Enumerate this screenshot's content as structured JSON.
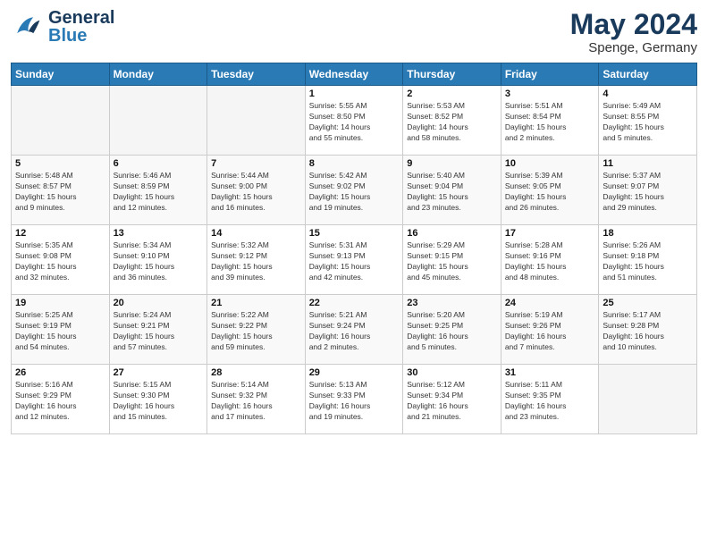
{
  "header": {
    "logo": {
      "general": "General",
      "blue": "Blue"
    },
    "title": "May 2024",
    "location": "Spenge, Germany"
  },
  "weekdays": [
    "Sunday",
    "Monday",
    "Tuesday",
    "Wednesday",
    "Thursday",
    "Friday",
    "Saturday"
  ],
  "weeks": [
    [
      {
        "day": "",
        "info": ""
      },
      {
        "day": "",
        "info": ""
      },
      {
        "day": "",
        "info": ""
      },
      {
        "day": "1",
        "info": "Sunrise: 5:55 AM\nSunset: 8:50 PM\nDaylight: 14 hours\nand 55 minutes."
      },
      {
        "day": "2",
        "info": "Sunrise: 5:53 AM\nSunset: 8:52 PM\nDaylight: 14 hours\nand 58 minutes."
      },
      {
        "day": "3",
        "info": "Sunrise: 5:51 AM\nSunset: 8:54 PM\nDaylight: 15 hours\nand 2 minutes."
      },
      {
        "day": "4",
        "info": "Sunrise: 5:49 AM\nSunset: 8:55 PM\nDaylight: 15 hours\nand 5 minutes."
      }
    ],
    [
      {
        "day": "5",
        "info": "Sunrise: 5:48 AM\nSunset: 8:57 PM\nDaylight: 15 hours\nand 9 minutes."
      },
      {
        "day": "6",
        "info": "Sunrise: 5:46 AM\nSunset: 8:59 PM\nDaylight: 15 hours\nand 12 minutes."
      },
      {
        "day": "7",
        "info": "Sunrise: 5:44 AM\nSunset: 9:00 PM\nDaylight: 15 hours\nand 16 minutes."
      },
      {
        "day": "8",
        "info": "Sunrise: 5:42 AM\nSunset: 9:02 PM\nDaylight: 15 hours\nand 19 minutes."
      },
      {
        "day": "9",
        "info": "Sunrise: 5:40 AM\nSunset: 9:04 PM\nDaylight: 15 hours\nand 23 minutes."
      },
      {
        "day": "10",
        "info": "Sunrise: 5:39 AM\nSunset: 9:05 PM\nDaylight: 15 hours\nand 26 minutes."
      },
      {
        "day": "11",
        "info": "Sunrise: 5:37 AM\nSunset: 9:07 PM\nDaylight: 15 hours\nand 29 minutes."
      }
    ],
    [
      {
        "day": "12",
        "info": "Sunrise: 5:35 AM\nSunset: 9:08 PM\nDaylight: 15 hours\nand 32 minutes."
      },
      {
        "day": "13",
        "info": "Sunrise: 5:34 AM\nSunset: 9:10 PM\nDaylight: 15 hours\nand 36 minutes."
      },
      {
        "day": "14",
        "info": "Sunrise: 5:32 AM\nSunset: 9:12 PM\nDaylight: 15 hours\nand 39 minutes."
      },
      {
        "day": "15",
        "info": "Sunrise: 5:31 AM\nSunset: 9:13 PM\nDaylight: 15 hours\nand 42 minutes."
      },
      {
        "day": "16",
        "info": "Sunrise: 5:29 AM\nSunset: 9:15 PM\nDaylight: 15 hours\nand 45 minutes."
      },
      {
        "day": "17",
        "info": "Sunrise: 5:28 AM\nSunset: 9:16 PM\nDaylight: 15 hours\nand 48 minutes."
      },
      {
        "day": "18",
        "info": "Sunrise: 5:26 AM\nSunset: 9:18 PM\nDaylight: 15 hours\nand 51 minutes."
      }
    ],
    [
      {
        "day": "19",
        "info": "Sunrise: 5:25 AM\nSunset: 9:19 PM\nDaylight: 15 hours\nand 54 minutes."
      },
      {
        "day": "20",
        "info": "Sunrise: 5:24 AM\nSunset: 9:21 PM\nDaylight: 15 hours\nand 57 minutes."
      },
      {
        "day": "21",
        "info": "Sunrise: 5:22 AM\nSunset: 9:22 PM\nDaylight: 15 hours\nand 59 minutes."
      },
      {
        "day": "22",
        "info": "Sunrise: 5:21 AM\nSunset: 9:24 PM\nDaylight: 16 hours\nand 2 minutes."
      },
      {
        "day": "23",
        "info": "Sunrise: 5:20 AM\nSunset: 9:25 PM\nDaylight: 16 hours\nand 5 minutes."
      },
      {
        "day": "24",
        "info": "Sunrise: 5:19 AM\nSunset: 9:26 PM\nDaylight: 16 hours\nand 7 minutes."
      },
      {
        "day": "25",
        "info": "Sunrise: 5:17 AM\nSunset: 9:28 PM\nDaylight: 16 hours\nand 10 minutes."
      }
    ],
    [
      {
        "day": "26",
        "info": "Sunrise: 5:16 AM\nSunset: 9:29 PM\nDaylight: 16 hours\nand 12 minutes."
      },
      {
        "day": "27",
        "info": "Sunrise: 5:15 AM\nSunset: 9:30 PM\nDaylight: 16 hours\nand 15 minutes."
      },
      {
        "day": "28",
        "info": "Sunrise: 5:14 AM\nSunset: 9:32 PM\nDaylight: 16 hours\nand 17 minutes."
      },
      {
        "day": "29",
        "info": "Sunrise: 5:13 AM\nSunset: 9:33 PM\nDaylight: 16 hours\nand 19 minutes."
      },
      {
        "day": "30",
        "info": "Sunrise: 5:12 AM\nSunset: 9:34 PM\nDaylight: 16 hours\nand 21 minutes."
      },
      {
        "day": "31",
        "info": "Sunrise: 5:11 AM\nSunset: 9:35 PM\nDaylight: 16 hours\nand 23 minutes."
      },
      {
        "day": "",
        "info": ""
      }
    ]
  ]
}
